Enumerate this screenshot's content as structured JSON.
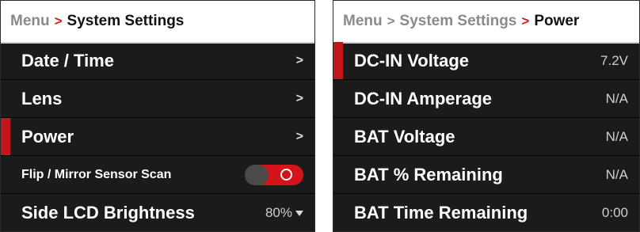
{
  "left_panel": {
    "breadcrumb": {
      "root": "Menu",
      "separator": ">",
      "current": "System Settings"
    },
    "items": [
      {
        "label": "Date / Time",
        "indicator": ">"
      },
      {
        "label": "Lens",
        "indicator": ">"
      },
      {
        "label": "Power",
        "indicator": ">",
        "selected": true
      },
      {
        "label": "Flip / Mirror Sensor Scan",
        "toggle": "on"
      },
      {
        "label": "Side LCD Brightness",
        "value": "80%"
      }
    ]
  },
  "right_panel": {
    "breadcrumb": {
      "root": "Menu",
      "sep1": ">",
      "parent": "System Settings",
      "sep2": ">",
      "current": "Power"
    },
    "items": [
      {
        "label": "DC-IN Voltage",
        "value": "7.2V",
        "selected": true
      },
      {
        "label": "DC-IN Amperage",
        "value": "N/A"
      },
      {
        "label": "BAT Voltage",
        "value": "N/A"
      },
      {
        "label": "BAT % Remaining",
        "value": "N/A"
      },
      {
        "label": "BAT Time Remaining",
        "value": "0:00"
      }
    ]
  },
  "colors": {
    "accent": "#c2161c",
    "panel_bg": "#1b1b1b",
    "header_bg": "#ffffff"
  }
}
